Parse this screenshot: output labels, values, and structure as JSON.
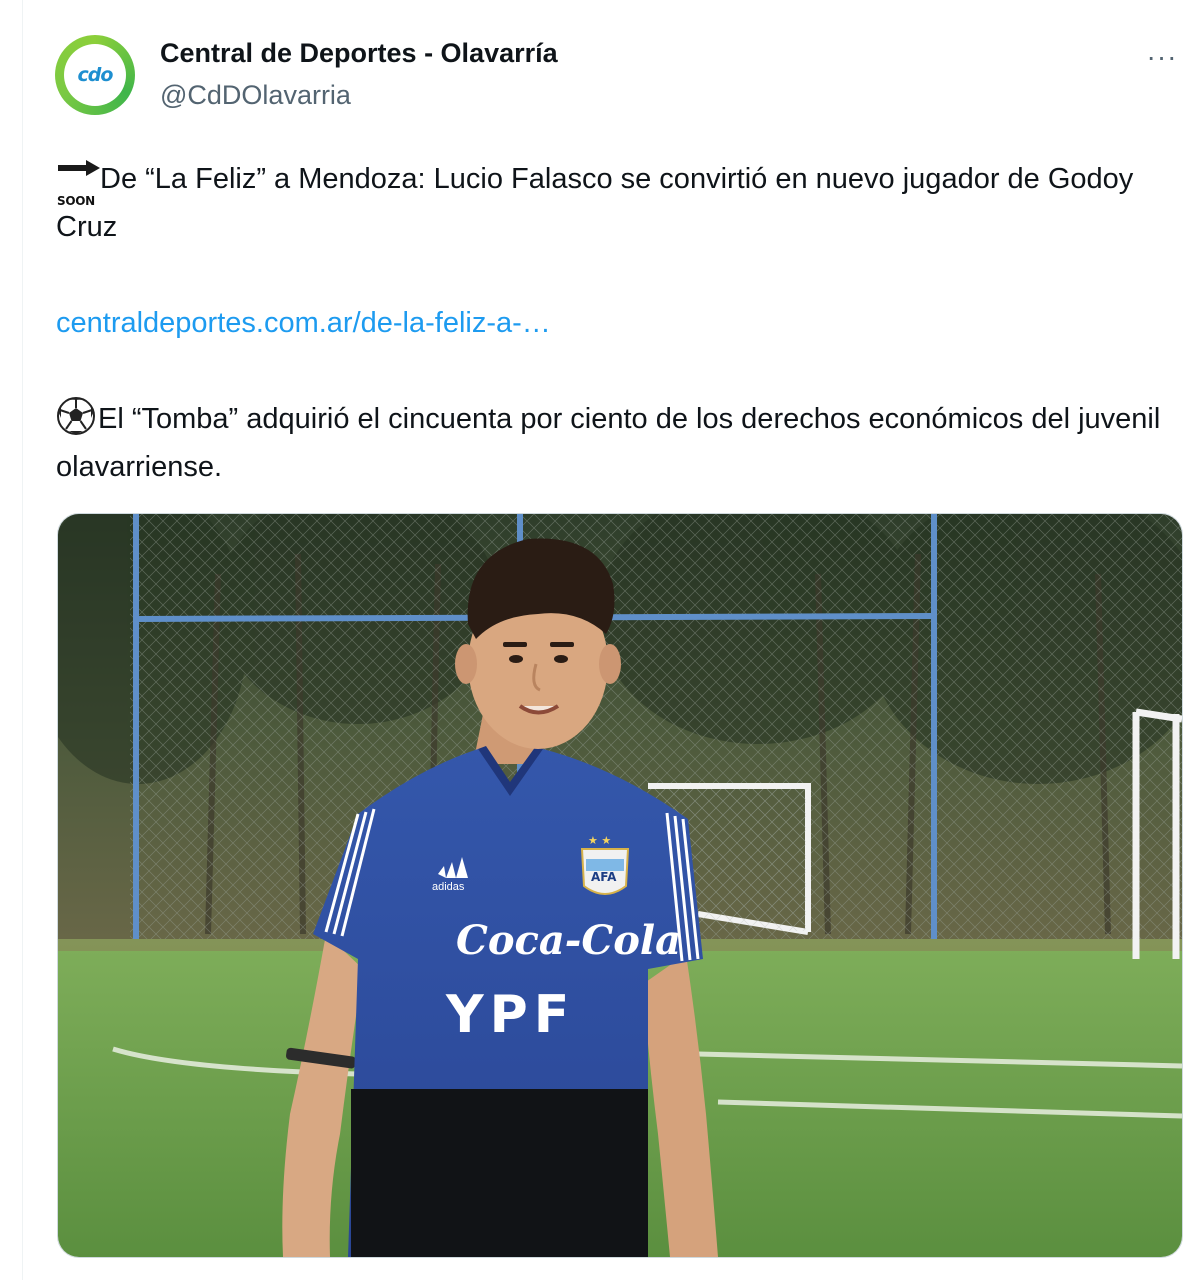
{
  "account": {
    "avatar_text": "cdo",
    "display_name": "Central de Deportes - Olavarría",
    "handle": "@CdDOlavarria",
    "more_label": "···"
  },
  "tweet": {
    "soon_label": "SOON",
    "line1": "De “La Feliz” a Mendoza: Lucio Falasco se convirtió en nuevo jugador de Godoy Cruz",
    "link": "centraldeportes.com.ar/de-la-feliz-a-…",
    "line2": "El “Tomba” adquirió el cincuenta por ciento de los derechos económicos del juvenil olavarriense."
  },
  "photo": {
    "shirt_brand": "adidas",
    "sponsor_1": "Coca-Cola",
    "sponsor_2": "YPF",
    "crest": "AFA"
  },
  "icons": {
    "soon": "soon-arrow-icon",
    "soccer": "soccer-ball-icon",
    "more": "more-icon"
  },
  "colors": {
    "link": "#1d9bf0",
    "text": "#0f1419",
    "secondary": "#536471",
    "jersey": "#2c4ea0",
    "grass": "#6fa04e"
  }
}
